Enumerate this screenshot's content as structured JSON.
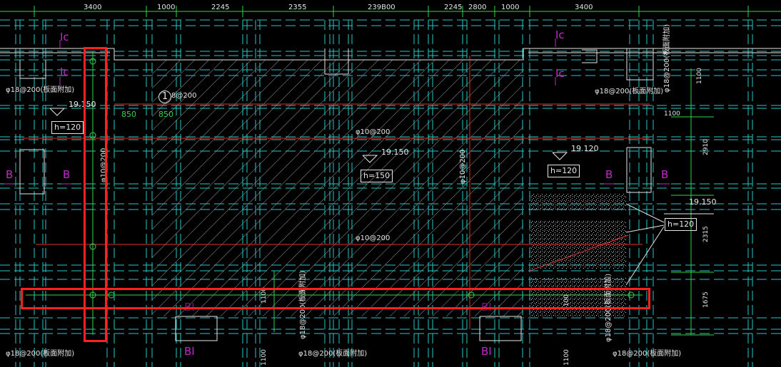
{
  "dimensions_top": [
    "3400",
    "1000",
    "2245",
    "2355",
    "239B00",
    "2245",
    "2800",
    "1000",
    "3400"
  ],
  "dimensions_right": [
    "1100",
    "1100",
    "2910",
    "2315",
    "1675"
  ],
  "section_marks": {
    "c_top_left": "Ic",
    "c_left": "Ic",
    "c_top_right": "Ic",
    "c_right": "Ic",
    "b_far_left": "B",
    "b_left": "B",
    "b_right": "B",
    "b_far_right": "B",
    "bi_left": "BI",
    "bi_right": "BI",
    "bi_faint_left": "BI",
    "bi_faint_right": "BI"
  },
  "elevations": [
    "19.150",
    "19.150",
    "19.120",
    "19.150"
  ],
  "thickness_boxes": [
    "h=120",
    "h=150",
    "h=120",
    "h=120"
  ],
  "rebar_labels": {
    "top_left": "φ18@200(板面附加)",
    "top_right": "φ18@200(板面附加)",
    "bottom_left": "φ18@200(板面附加)",
    "bottom_mid": "φ18@200(板面附加)",
    "bottom_right": "φ18@200(板面附加)",
    "center_top": "φ10@200",
    "center_bottom": "φ10@200",
    "vertical_center": "φ10@200",
    "vertical_left": "φ10@200",
    "vertical_bottom_mid": "φ18@200(板面附加)",
    "vertical_right_top": "φ18@200(板面附加)",
    "vertical_right_bottom": "φ18@200(板面附加)",
    "callout": "8@200",
    "callout_number": "1"
  },
  "green_dims": [
    "850",
    "850"
  ],
  "small_dims": [
    "1100",
    "1100",
    "1100",
    "1100"
  ],
  "colors": {
    "background": "#000000",
    "wall_lines": "#e6e6e6",
    "axis_green": "#34d24a",
    "dim_cyan": "#27c8c8",
    "rebar_red": "#e03030",
    "marker_magenta": "#c028c8",
    "highlight_red": "#ff2020"
  }
}
